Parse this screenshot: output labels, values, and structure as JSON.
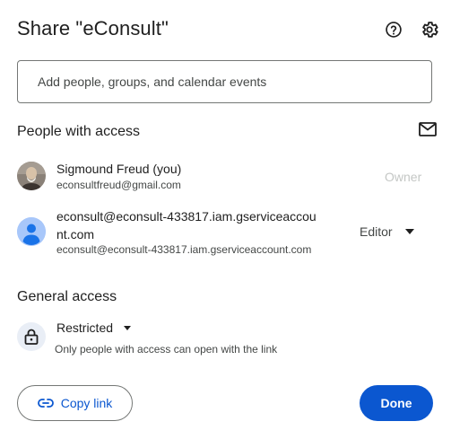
{
  "dialog": {
    "title": "Share \"eConsult\"",
    "help_icon": "help-circle-icon",
    "settings_icon": "gear-icon"
  },
  "add_people": {
    "placeholder": "Add people, groups, and calendar events",
    "value": ""
  },
  "people_with_access": {
    "heading": "People with access",
    "email_icon": "mail-icon",
    "people": [
      {
        "name": "Sigmound Freud (you)",
        "email": "econsultfreud@gmail.com",
        "role": "Owner",
        "avatar": "photo-avatar"
      },
      {
        "name_line1": "econsult@econsult-433817.iam.gserviceaccou",
        "name_line2": "nt.com",
        "email": "econsult@econsult-433817.iam.gserviceaccount.com",
        "role": "Editor",
        "avatar": "default-person-avatar"
      }
    ]
  },
  "general_access": {
    "heading": "General access",
    "level": "Restricted",
    "description": "Only people with access can open with the link"
  },
  "footer": {
    "copy_link_label": "Copy link",
    "done_label": "Done"
  },
  "colors": {
    "primary": "#0b57d0",
    "avatar_default": "#a8c7fa",
    "text": "#1f1f1f",
    "muted": "#444746"
  }
}
